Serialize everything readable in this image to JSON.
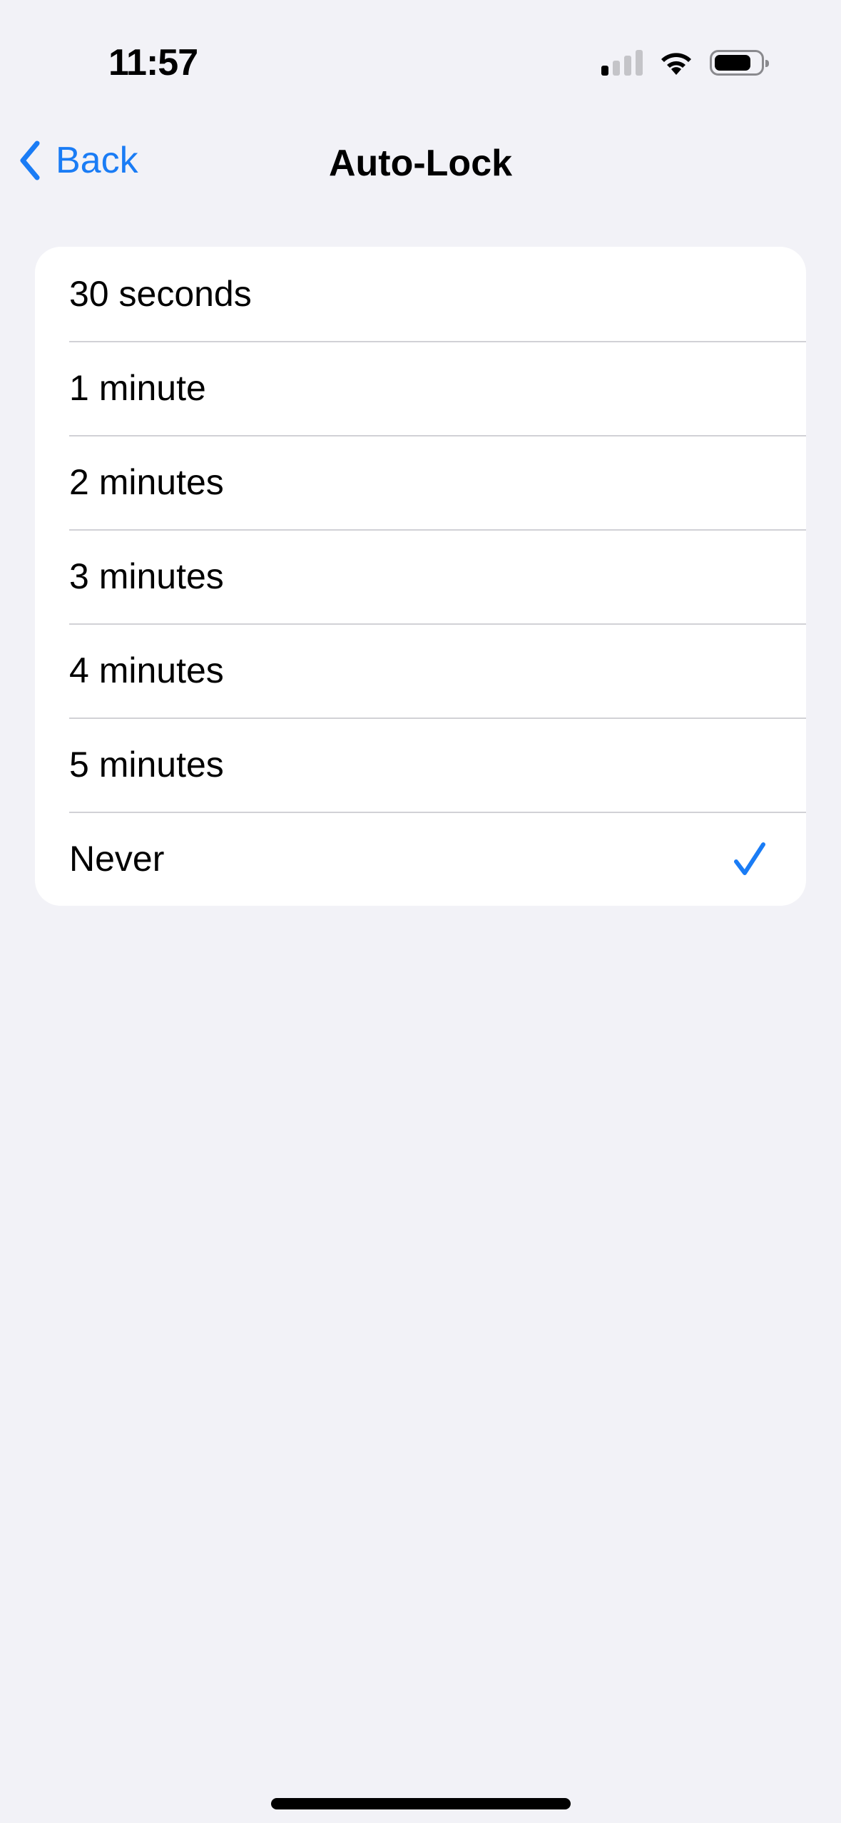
{
  "status_bar": {
    "time": "11:57",
    "signal_bars_active": 1,
    "signal_bars_total": 4,
    "wifi": "wifi-icon",
    "battery_level": 0.8
  },
  "nav": {
    "back_label": "Back",
    "title": "Auto-Lock"
  },
  "options": [
    {
      "label": "30 seconds",
      "selected": false
    },
    {
      "label": "1 minute",
      "selected": false
    },
    {
      "label": "2 minutes",
      "selected": false
    },
    {
      "label": "3 minutes",
      "selected": false
    },
    {
      "label": "4 minutes",
      "selected": false
    },
    {
      "label": "5 minutes",
      "selected": false
    },
    {
      "label": "Never",
      "selected": true
    }
  ],
  "colors": {
    "accent": "#1a7cf5",
    "background": "#f2f2f7",
    "card": "#ffffff",
    "separator": "#d1d1d6"
  }
}
